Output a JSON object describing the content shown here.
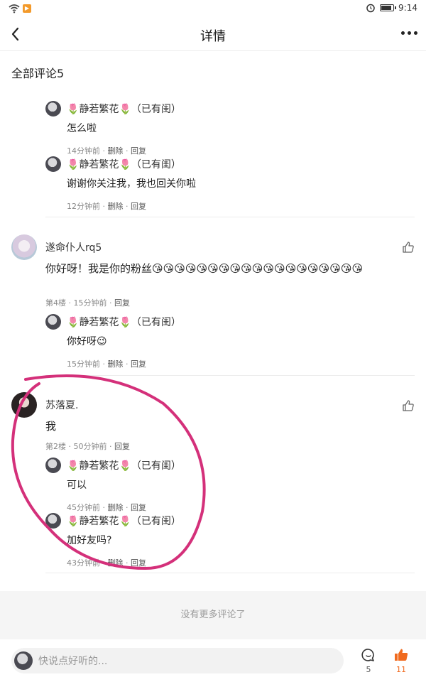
{
  "status_bar": {
    "time": "9:14",
    "battery_level": 0.85
  },
  "nav": {
    "title": "详情"
  },
  "section": {
    "title": "全部评论5"
  },
  "reply_author": {
    "flower": "🌷",
    "name": "静若繁花",
    "suffix": "（已有闺）"
  },
  "thread1": {
    "replies": [
      {
        "text": "怎么啦",
        "time": "14分钟前",
        "delete": "删除",
        "reply": "回复"
      },
      {
        "text": "谢谢你关注我，我也回关你啦",
        "time": "12分钟前",
        "delete": "删除",
        "reply": "回复"
      }
    ]
  },
  "comment_rq5": {
    "name": "遂命仆人rq5",
    "text": "你好呀！我是你的粉丝😘😘😘😘😘😘😘😘😘😘😘😘😘😘😘😘😘😘😘",
    "floor": "第4楼",
    "time": "15分钟前",
    "reply": "回复",
    "replies": [
      {
        "text": "你好呀😉",
        "time": "15分钟前",
        "delete": "删除",
        "reply": "回复"
      }
    ]
  },
  "comment_su": {
    "name": "苏落夏.",
    "text": "我",
    "floor": "第2楼",
    "time": "50分钟前",
    "reply": "回复",
    "replies": [
      {
        "text": "可以",
        "time": "45分钟前",
        "delete": "删除",
        "reply": "回复"
      },
      {
        "text": "加好友吗?",
        "time": "43分钟前",
        "delete": "删除",
        "reply": "回复"
      }
    ]
  },
  "footer": {
    "no_more": "没有更多评论了"
  },
  "bottom_bar": {
    "placeholder": "快说点好听的...",
    "comment_count": "5",
    "like_count": "11"
  },
  "colors": {
    "accent": "#f06a1e",
    "annotation": "#d4307a"
  }
}
